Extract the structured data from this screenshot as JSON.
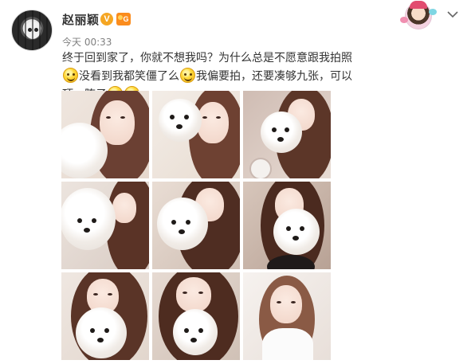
{
  "post": {
    "username": "赵丽颖",
    "verified_badge": "V",
    "level_badge": "G",
    "time": "今天 00:33",
    "text_1": "终于回到家了，你就不想我吗？为什么总是不愿意跟我拍照",
    "text_2": "没看到我都笑僵了么",
    "text_3": "我偏要拍，还要凑够九张，可以顶一阵子"
  },
  "icons": {
    "avatar": "user-avatar-icon",
    "chevron": "chevron-down-icon",
    "emoji_1": "smirk-emoji-icon",
    "emoji_2": "grin-emoji-icon",
    "emoji_3": "wink-emoji-icon"
  },
  "colors": {
    "verified": "#f5a623",
    "level": "#fb8c1d",
    "username": "#333333",
    "time": "#808080"
  },
  "photos": [
    {
      "label": "photo-1"
    },
    {
      "label": "photo-2"
    },
    {
      "label": "photo-3"
    },
    {
      "label": "photo-4"
    },
    {
      "label": "photo-5"
    },
    {
      "label": "photo-6"
    },
    {
      "label": "photo-7"
    },
    {
      "label": "photo-8"
    },
    {
      "label": "photo-9"
    }
  ]
}
